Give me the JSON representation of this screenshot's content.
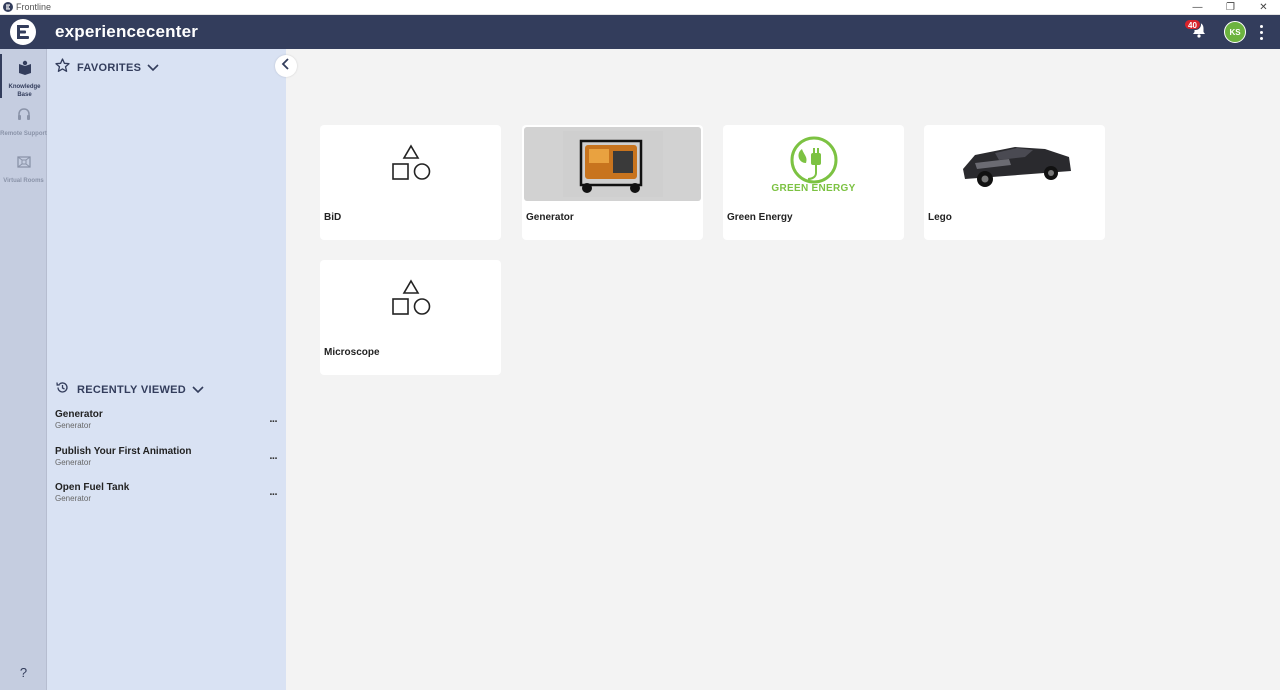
{
  "os": {
    "title": "Frontline",
    "minimize": "—",
    "restore": "❐",
    "close": "✕"
  },
  "header": {
    "title": "experiencecenter",
    "notification_count": "40",
    "avatar_initials": "KS"
  },
  "rail": {
    "items": [
      {
        "label": "Knowledge Base",
        "icon": "book-icon",
        "active": true
      },
      {
        "label": "Remote Support",
        "icon": "headset-icon",
        "active": false
      },
      {
        "label": "Virtual Rooms",
        "icon": "rooms-icon",
        "active": false
      }
    ],
    "help": "?"
  },
  "panel": {
    "favorites_label": "FAVORITES",
    "recent_label": "RECENTLY VIEWED",
    "recent": [
      {
        "title": "Generator",
        "sub": "Generator"
      },
      {
        "title": "Publish Your First Animation",
        "sub": "Generator"
      },
      {
        "title": "Open Fuel Tank",
        "sub": "Generator"
      }
    ],
    "more_label": "..."
  },
  "cards": [
    {
      "title": "BiD",
      "thumb": "shapes-placeholder"
    },
    {
      "title": "Generator",
      "thumb": "generator-photo"
    },
    {
      "title": "Green Energy",
      "thumb": "green-energy-logo",
      "logo_text": "GREEN ENERGY",
      "logo_color": "#7cc242"
    },
    {
      "title": "Lego",
      "thumb": "car-photo"
    },
    {
      "title": "Microscope",
      "thumb": "shapes-placeholder"
    }
  ],
  "colors": {
    "header_bg": "#333d5c",
    "panel_bg": "#d9e2f3",
    "rail_bg": "#c5cde0",
    "accent_green": "#6cb33f",
    "badge_red": "#d8232a"
  }
}
